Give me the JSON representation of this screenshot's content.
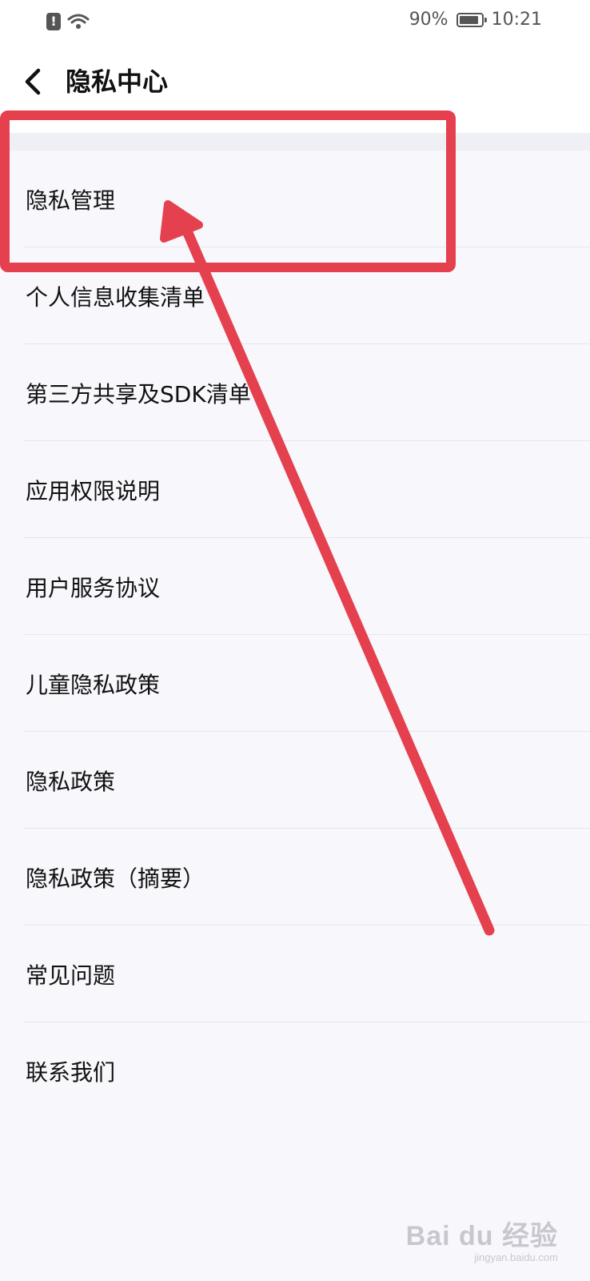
{
  "status_bar": {
    "battery": "90%",
    "battery_level": 0.9,
    "time": "10:21"
  },
  "header": {
    "title": "隐私中心",
    "back_icon": "chevron-left-icon"
  },
  "menu": {
    "items": [
      {
        "label": "隐私管理"
      },
      {
        "label": "个人信息收集清单"
      },
      {
        "label": "第三方共享及SDK清单"
      },
      {
        "label": "应用权限说明"
      },
      {
        "label": "用户服务协议"
      },
      {
        "label": "儿童隐私政策"
      },
      {
        "label": "隐私政策"
      },
      {
        "label": "隐私政策（摘要）"
      },
      {
        "label": "常见问题"
      },
      {
        "label": "联系我们"
      }
    ]
  },
  "annotation": {
    "color": "#e5404e",
    "highlighted_item": "隐私管理"
  },
  "watermark": {
    "brand": "Bai du 经验",
    "url": "jingyan.baidu.com"
  }
}
